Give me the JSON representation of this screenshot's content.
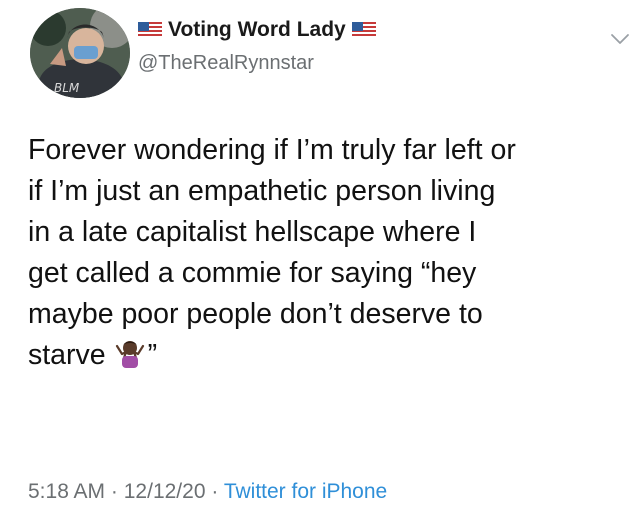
{
  "tweet": {
    "author": {
      "display_name": "Voting Word Lady",
      "handle": "@TheRealRynnstar",
      "badge_icon": "us-flag-icon"
    },
    "text_main": "Forever wondering if I’m truly far left or\nif I’m just an empathetic person living\nin a late capitalist hellscape where I\nget called a commie for saying “hey\nmaybe poor people don’t deserve to\nstarve",
    "text_end": "”",
    "emoji": "person-shrugging-emoji",
    "timestamp": "5:18 AM",
    "date": "12/12/20",
    "separator": "·",
    "source": "Twitter for iPhone",
    "more_icon": "chevron-down-icon",
    "colors": {
      "text": "#111111",
      "secondary": "#6b6f72",
      "link": "#2f8fd8"
    }
  }
}
